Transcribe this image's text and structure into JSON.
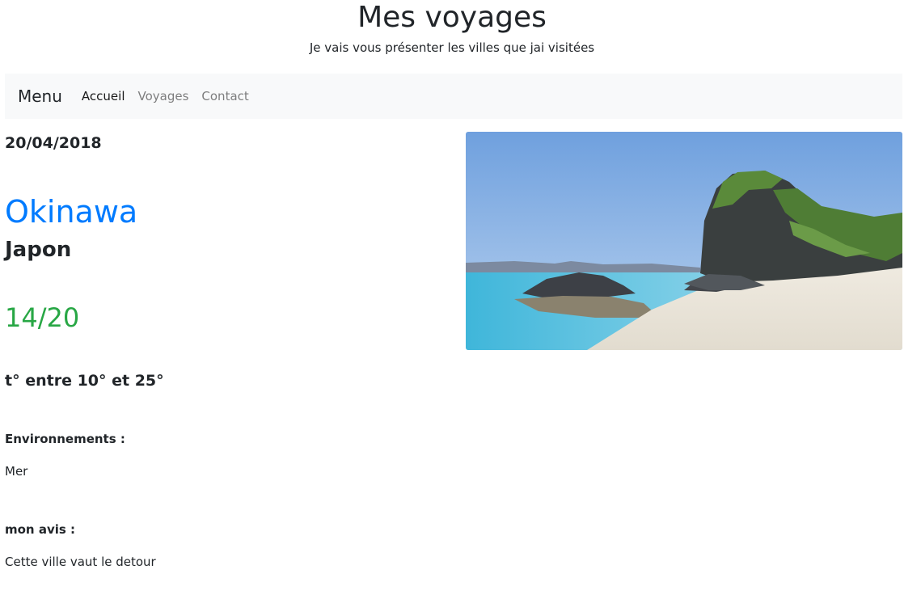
{
  "header": {
    "title": "Mes voyages",
    "subtitle": "Je vais vous présenter les villes que jai visitées"
  },
  "navbar": {
    "brand": "Menu",
    "links": [
      {
        "label": "Accueil",
        "active": true
      },
      {
        "label": "Voyages",
        "active": false
      },
      {
        "label": "Contact",
        "active": false
      }
    ]
  },
  "trip": {
    "date": "20/04/2018",
    "city": "Okinawa",
    "country": "Japon",
    "rating": "14/20",
    "temperature": "t° entre 10° et 25°",
    "environment_label": "Environnements :",
    "environment_value": "Mer",
    "opinion_label": "mon avis :",
    "opinion_value": "Cette ville vaut le detour"
  },
  "colors": {
    "city": "#007bff",
    "rating": "#28a745",
    "navbar_bg": "#f8f9fa"
  }
}
